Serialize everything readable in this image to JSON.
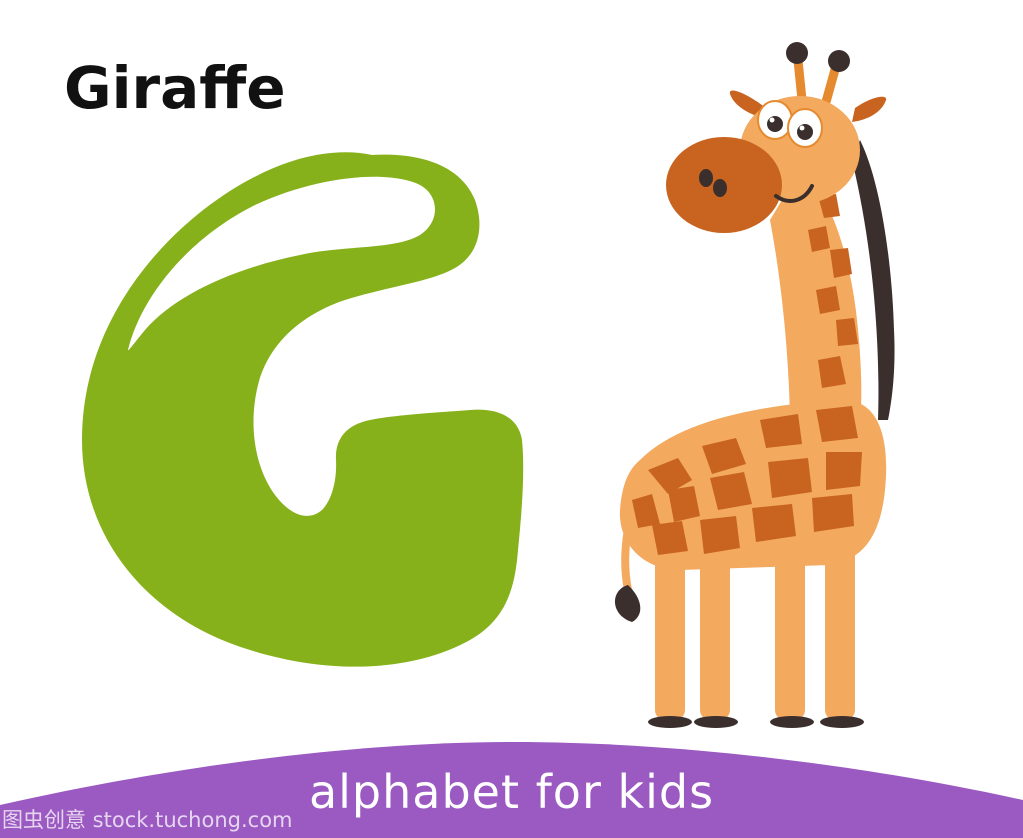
{
  "card": {
    "title": "Giraffe",
    "letter": "G",
    "footer_text": "alphabet for kids",
    "watermark": "图虫创意 stock.tuchong.com"
  },
  "colors": {
    "background": "#ffffff",
    "letter": "#86b11a",
    "letter_highlight": "#ffffff",
    "footer": "#9b59c2",
    "footer_text": "#ffffff",
    "giraffe_body": "#f3a95e",
    "giraffe_spots": "#c8641f",
    "giraffe_dark": "#3a2f2c"
  },
  "icons": {
    "letter": "letter-g-icon",
    "animal": "giraffe-icon"
  }
}
